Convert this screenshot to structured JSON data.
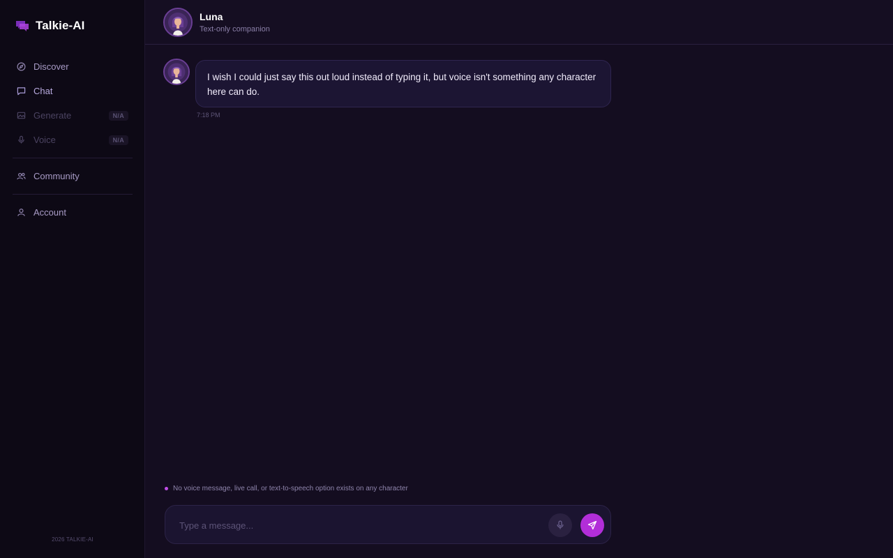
{
  "brand": {
    "name": "Talkie-AI",
    "logo_color": "#a23fd6"
  },
  "sidebar": {
    "items": [
      {
        "label": "Discover",
        "icon": "compass-icon",
        "state": "normal"
      },
      {
        "label": "Chat",
        "icon": "chat-icon",
        "state": "active"
      },
      {
        "label": "Generate",
        "icon": "image-icon",
        "state": "disabled",
        "badge": "N/A"
      },
      {
        "label": "Voice",
        "icon": "mic-icon",
        "state": "disabled",
        "badge": "N/A"
      },
      {
        "label": "Community",
        "icon": "users-icon",
        "state": "normal"
      },
      {
        "label": "Account",
        "icon": "user-icon",
        "state": "normal"
      }
    ],
    "copyright": "2026 TALKIE-AI"
  },
  "header": {
    "name": "Luna",
    "subtitle": "Text-only companion"
  },
  "messages": [
    {
      "text": "I wish I could just say this out loud instead of typing it, but voice isn't something any character here can do.",
      "time": "7:18 PM"
    }
  ],
  "notice": "No voice message, live call, or text-to-speech option exists on any character",
  "composer": {
    "placeholder": "Type a message...",
    "value": ""
  },
  "colors": {
    "accent": "#b22ed8",
    "background": "#140d20",
    "sidebar": "#0d0915",
    "bubble": "#1c1533"
  }
}
